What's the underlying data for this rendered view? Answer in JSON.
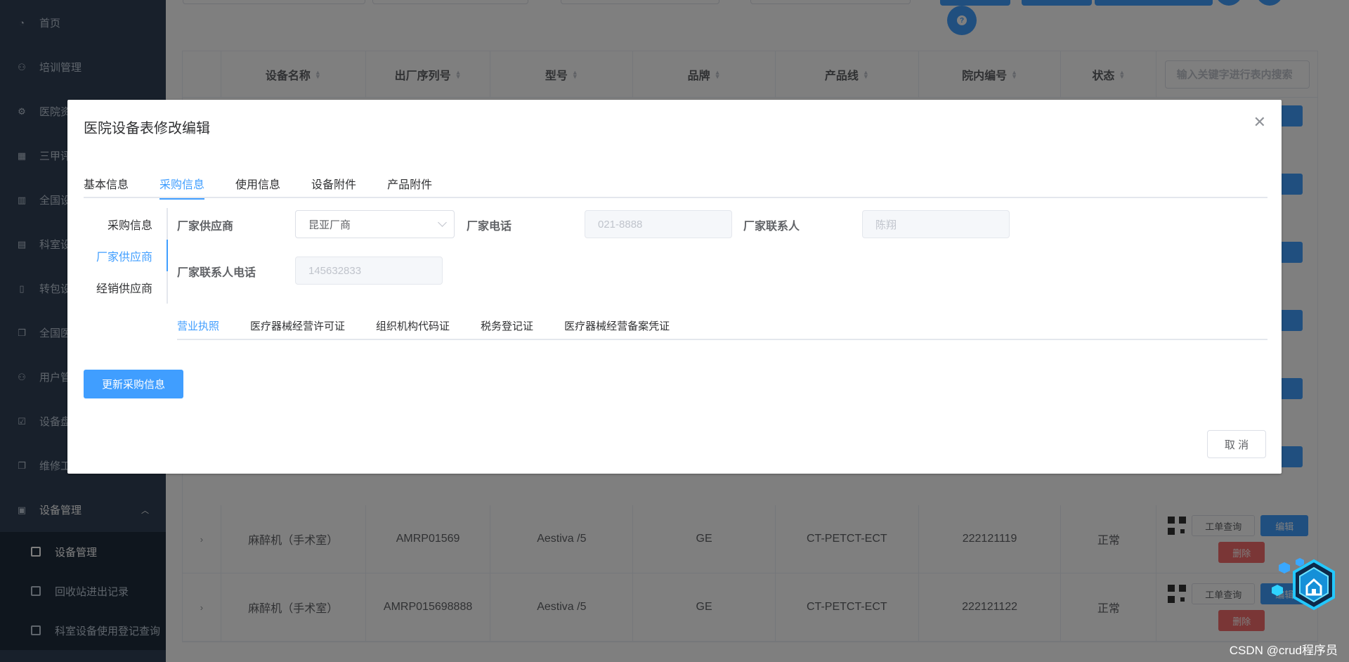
{
  "sidebar": {
    "items": [
      {
        "label": "首页",
        "icon": "dashboard-icon"
      },
      {
        "label": "培训管理",
        "icon": "user-icon"
      },
      {
        "label": "医院资",
        "icon": "settings-icon"
      },
      {
        "label": "三甲评",
        "icon": "grid-icon"
      },
      {
        "label": "全国设",
        "icon": "book-icon"
      },
      {
        "label": "科室设",
        "icon": "building-icon"
      },
      {
        "label": "转包设",
        "icon": "document-icon"
      },
      {
        "label": "全国医",
        "icon": "copy-icon"
      },
      {
        "label": "用户管",
        "icon": "user-icon"
      },
      {
        "label": "设备盘",
        "icon": "checkbox-icon"
      },
      {
        "label": "维修工",
        "icon": "copy-icon"
      },
      {
        "label": "设备管理",
        "icon": "device-icon"
      }
    ],
    "submenu": [
      {
        "label": "设备管理"
      },
      {
        "label": "回收站进出记录"
      },
      {
        "label": "科室设备使用登记查询"
      }
    ]
  },
  "table": {
    "headers": [
      "设备名称",
      "出厂序列号",
      "型号",
      "品牌",
      "产品线",
      "院内编号",
      "状态"
    ],
    "search_placeholder": "输入关键字进行表内搜索",
    "rows": [
      {
        "name": "麻醉机（手术室）",
        "serial": "AMRP01569",
        "model": "Aestiva /5",
        "brand": "GE",
        "line": "CT-PETCT-ECT",
        "code": "222121119",
        "status": "正常"
      },
      {
        "name": "麻醉机（手术室）",
        "serial": "AMRP015698888",
        "model": "Aestiva /5",
        "brand": "GE",
        "line": "CT-PETCT-ECT",
        "code": "222121122",
        "status": "正常"
      }
    ],
    "actions": {
      "work_order": "工单查询",
      "edit": "编辑",
      "delete": "删除"
    }
  },
  "dialog": {
    "title": "医院设备表修改编辑",
    "tabs": [
      "基本信息",
      "采购信息",
      "使用信息",
      "设备附件",
      "产品附件"
    ],
    "active_tab": "采购信息",
    "vtabs": [
      "采购信息",
      "厂家供应商",
      "经销供应商"
    ],
    "form": {
      "supplier_label": "厂家供应商",
      "supplier_value": "昆亚厂商",
      "phone_label": "厂家电话",
      "phone_placeholder": "021-8888",
      "contact_label": "厂家联系人",
      "contact_placeholder": "陈翔",
      "contact_phone_label": "厂家联系人电话",
      "contact_phone_placeholder": "145632833"
    },
    "subtabs": [
      "营业执照",
      "医疗器械经营许可证",
      "组织机构代码证",
      "税务登记证",
      "医疗器械经营备案凭证"
    ],
    "update_button": "更新采购信息",
    "cancel_button": "取 消"
  },
  "watermark": "CSDN @crud程序员",
  "colors": {
    "primary": "#409eff",
    "danger": "#f56c6c",
    "sidebar": "#304156"
  }
}
